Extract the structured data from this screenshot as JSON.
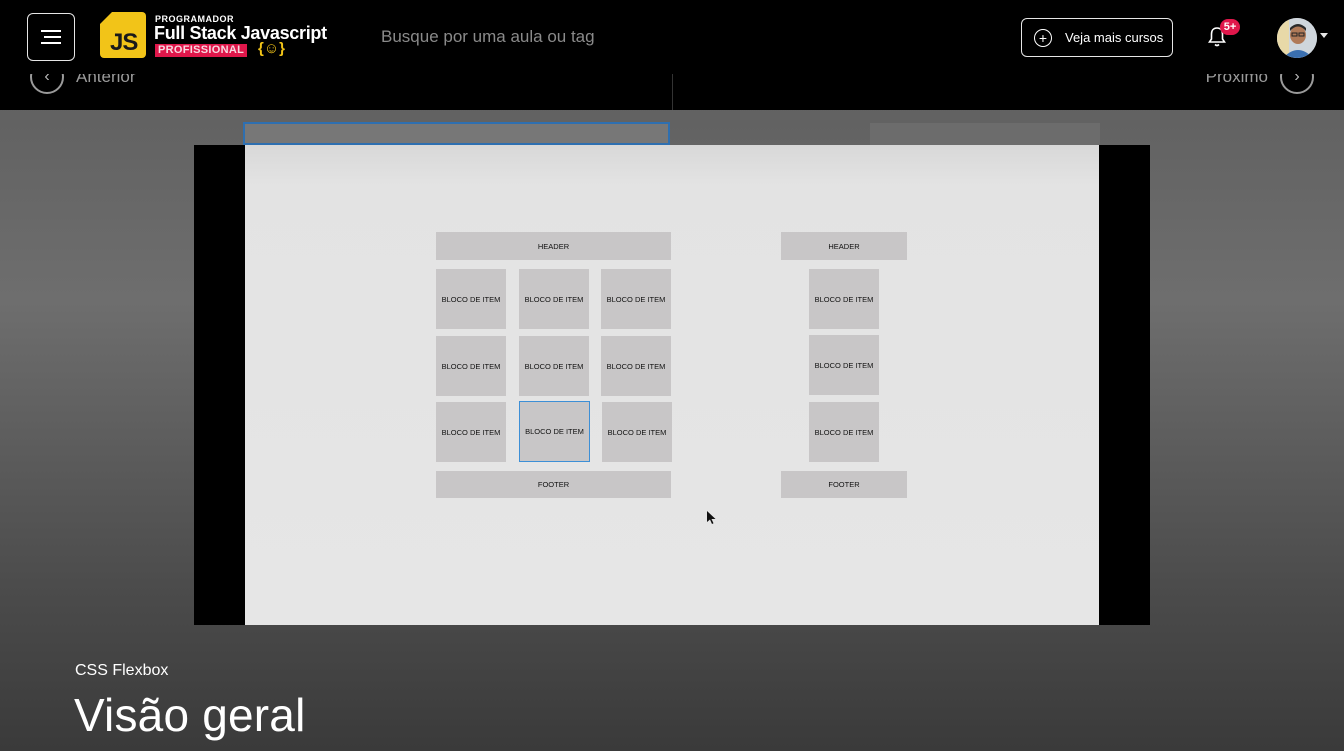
{
  "header": {
    "menu_icon": "hamburger-menu-icon",
    "logo": {
      "badge_text": "JS",
      "small_text": "PROGRAMADOR",
      "title": "Full Stack Javascript",
      "tag": "PROFISSIONAL",
      "brace_glyph": "{☺}"
    },
    "search_placeholder": "Busque por uma aula ou tag",
    "courses_button_label": "Veja mais cursos",
    "notification_badge": "5+",
    "accent_color": "#e0174b",
    "logo_yellow": "#f2c418"
  },
  "nav": {
    "prev_label": "Anterior",
    "next_label": "Próximo"
  },
  "slide": {
    "left_layout": {
      "header": "HEADER",
      "items": [
        "BLOCO DE ITEM",
        "BLOCO DE ITEM",
        "BLOCO DE ITEM",
        "BLOCO DE ITEM",
        "BLOCO DE ITEM",
        "BLOCO DE ITEM",
        "BLOCO DE ITEM",
        "BLOCO DE ITEM",
        "BLOCO DE ITEM"
      ],
      "footer": "FOOTER"
    },
    "right_layout": {
      "header": "HEADER",
      "items": [
        "BLOCO DE ITEM",
        "BLOCO DE ITEM",
        "BLOCO DE ITEM"
      ],
      "footer": "FOOTER"
    }
  },
  "lesson": {
    "course_module": "CSS Flexbox",
    "title": "Visão geral"
  }
}
